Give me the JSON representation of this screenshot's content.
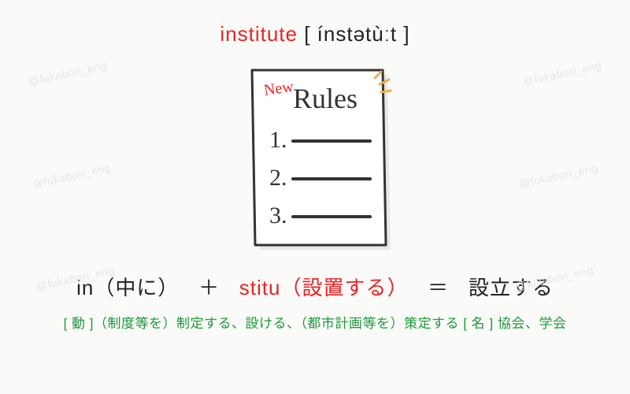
{
  "watermark": "@fukabori_eng",
  "title": {
    "word": "institute",
    "bracket_open": " [ ",
    "pronunciation": "ínstətùːt",
    "bracket_close": " ]"
  },
  "illustration": {
    "badge": "New",
    "heading": "Rules",
    "items": [
      "1.",
      "2.",
      "3."
    ]
  },
  "etymology": {
    "part1_prefix": "in",
    "part1_meaning": "（中に）",
    "plus": "＋",
    "part2_root": "stitu",
    "part2_meaning": "（設置する）",
    "equals": "＝",
    "result": "設立する"
  },
  "definition": "[ 動 ]（制度等を）制定する、設ける、（都市計画等を）策定する [ 名 ] 協会、学会"
}
